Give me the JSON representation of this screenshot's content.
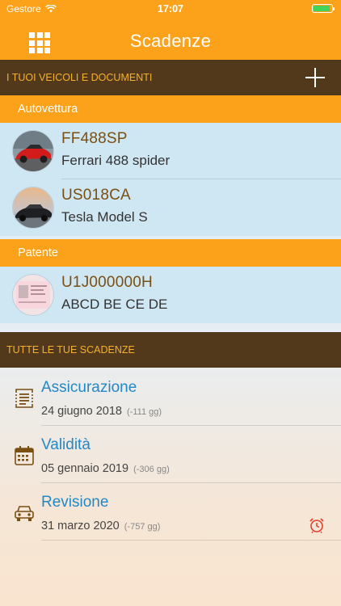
{
  "status_bar": {
    "carrier": "Gestore",
    "time": "17:07",
    "battery_level": 0.9,
    "battery_color": "#44d35a"
  },
  "nav": {
    "title": "Scadenze",
    "left_icon": "grid-icon"
  },
  "colors": {
    "orange": "#fba21a",
    "brown": "#52391c",
    "section_text": "#f6b02c",
    "link_blue": "#2388c4",
    "plate_brown": "#7a4f12"
  },
  "vehicles_section": {
    "title": "I TUOI VEICOLI E DOCUMENTI",
    "add_icon": "plus-icon"
  },
  "categories": [
    {
      "label": "Autovettura",
      "items": [
        {
          "plate": "FF488SP",
          "model": "Ferrari 488 spider",
          "avatar": "red-sports-car"
        },
        {
          "plate": "US018CA",
          "model": "Tesla Model S",
          "avatar": "black-sedan-sunset"
        }
      ]
    },
    {
      "label": "Patente",
      "items": [
        {
          "plate": "U1J000000H",
          "model": "ABCD BE CE DE",
          "avatar": "driving-license-card"
        }
      ]
    }
  ],
  "deadlines_section": {
    "title": "TUTTE LE TUE SCADENZE"
  },
  "deadlines": [
    {
      "name": "Assicurazione",
      "date": "24 giugno 2018",
      "delta": "(-111 gg)",
      "icon": "document-list-icon",
      "alarm": false
    },
    {
      "name": "Validità",
      "date": "05 gennaio 2019",
      "delta": "(-306 gg)",
      "icon": "calendar-icon",
      "alarm": false
    },
    {
      "name": "Revisione",
      "date": "31 marzo 2020",
      "delta": "(-757 gg)",
      "icon": "car-front-icon",
      "alarm": true,
      "alarm_icon": "alarm-clock-icon"
    }
  ]
}
